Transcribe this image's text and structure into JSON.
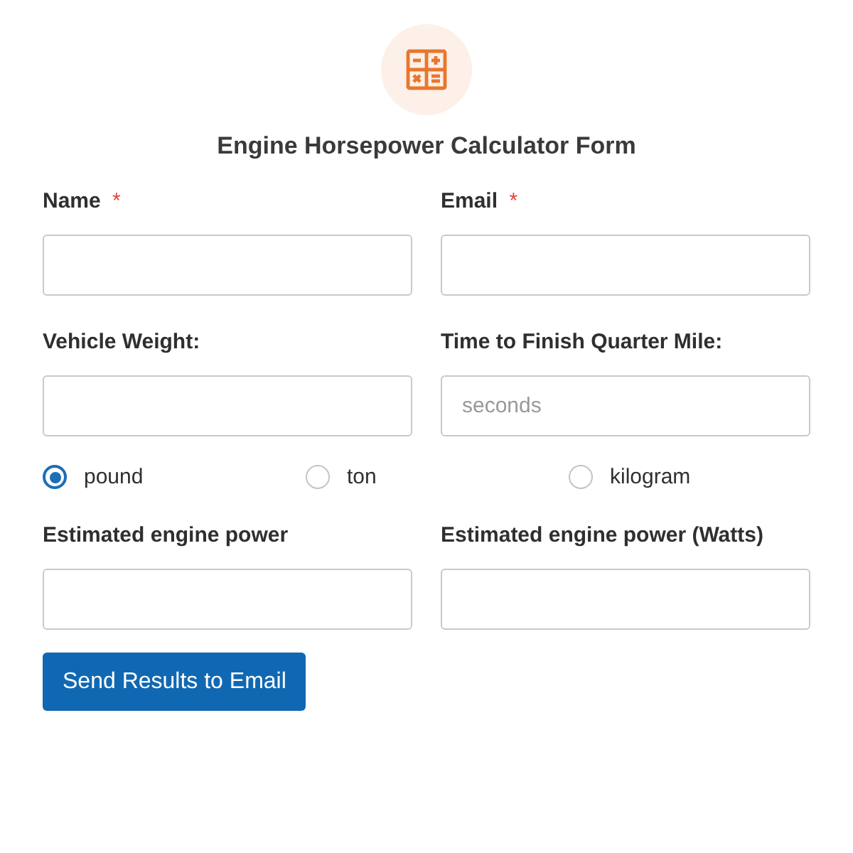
{
  "title": "Engine Horsepower Calculator Form",
  "rows": [
    [
      {
        "label": "Name",
        "required_mark": "*"
      },
      {
        "label": "Email",
        "required_mark": "*"
      }
    ],
    [
      {
        "label": "Vehicle Weight:"
      },
      {
        "label": "Time to Finish Quarter Mile:",
        "placeholder": "seconds"
      }
    ]
  ],
  "units": [
    {
      "label": "pound",
      "selected": true
    },
    {
      "label": "ton",
      "selected": false
    },
    {
      "label": "kilogram",
      "selected": false
    }
  ],
  "outputs": [
    {
      "label": "Estimated engine power"
    },
    {
      "label": "Estimated engine power (Watts)"
    }
  ],
  "submit": "Send Results to Email"
}
